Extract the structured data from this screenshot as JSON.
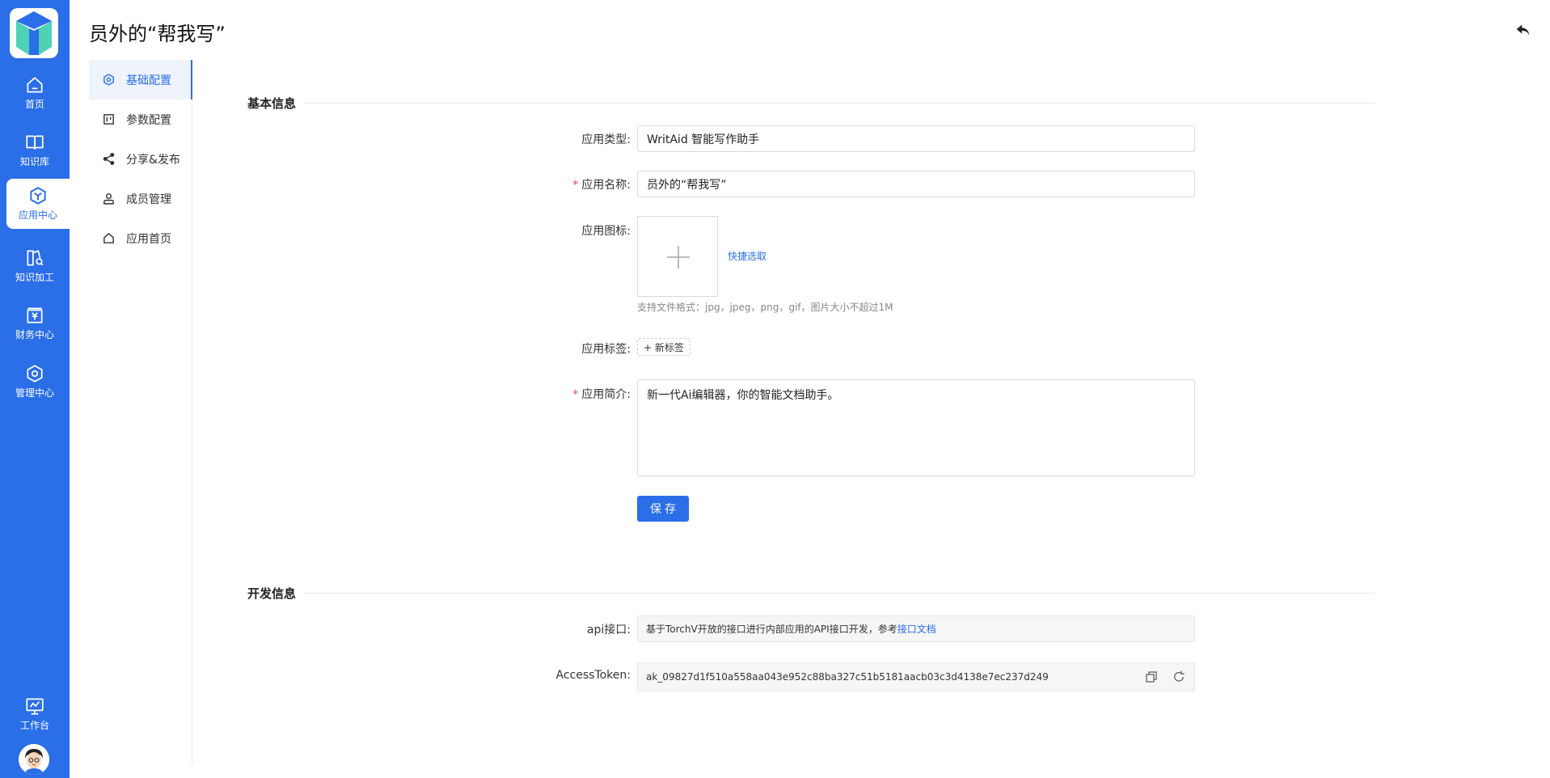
{
  "header": {
    "title": "员外的“帮我写”"
  },
  "rail": {
    "items": [
      {
        "label": "首页",
        "icon": "home-icon"
      },
      {
        "label": "知识库",
        "icon": "book-icon"
      },
      {
        "label": "应用中心",
        "icon": "app-center-icon",
        "active": true
      },
      {
        "label": "知识加工",
        "icon": "knowledge-process-icon"
      },
      {
        "label": "财务中心",
        "icon": "finance-icon"
      },
      {
        "label": "管理中心",
        "icon": "admin-gear-icon"
      }
    ],
    "workbench": {
      "label": "工作台",
      "icon": "workbench-icon"
    }
  },
  "subnav": {
    "items": [
      {
        "label": "基础配置",
        "icon": "basic-config-icon",
        "active": true
      },
      {
        "label": "参数配置",
        "icon": "param-config-icon"
      },
      {
        "label": "分享&发布",
        "icon": "share-icon"
      },
      {
        "label": "成员管理",
        "icon": "member-icon"
      },
      {
        "label": "应用首页",
        "icon": "app-home-icon"
      }
    ]
  },
  "basic": {
    "section_title": "基本信息",
    "type_label": "应用类型:",
    "type_value": "WritAid 智能写作助手",
    "name_label": "应用名称:",
    "name_value": "员外的“帮我写”",
    "icon_label": "应用图标:",
    "quick_pick": "快捷选取",
    "hint": "支持文件格式：jpg，jpeg，png，gif，图片大小不超过1M",
    "tags_label": "应用标签:",
    "new_tag": "+ 新标签",
    "intro_label": "应用简介:",
    "intro_value": "新一代Ai编辑器，你的智能文档助手。",
    "save": "保存"
  },
  "dev": {
    "section_title": "开发信息",
    "api_label": "api接口:",
    "api_text": "基于TorchV开放的接口进行内部应用的API接口开发，参考",
    "api_link": "接口文档",
    "token_label": "AccessToken:",
    "token_value": "ak_09827d1f510a558aa043e952c88ba327c51b5181aacb03c3d4138e7ec237d249"
  },
  "colors": {
    "primary": "#2a6ee8",
    "required": "#e5484d"
  }
}
